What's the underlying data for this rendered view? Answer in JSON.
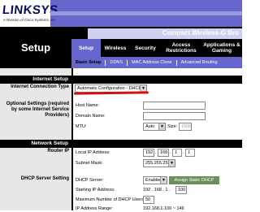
{
  "header": {
    "logo": "LINKSYS",
    "logo_sub": "A Division of Cisco Systems, Inc.",
    "product_name": "Compact Wireless-G Bro"
  },
  "nav": {
    "section_title": "Setup",
    "tabs": [
      {
        "label": "Setup",
        "active": true
      },
      {
        "label": "Wireless",
        "active": false
      },
      {
        "label": "Security",
        "active": false
      },
      {
        "label": "Access Restrictions",
        "active": false
      },
      {
        "label": "Applications & Gaming",
        "active": false
      }
    ],
    "subtabs": [
      {
        "label": "Basic Setup",
        "active": true
      },
      {
        "label": "DDNS",
        "active": false
      },
      {
        "label": "MAC Address Clone",
        "active": false
      },
      {
        "label": "Advanced Routing",
        "active": false
      }
    ]
  },
  "left": {
    "internet_setup": "Internet Setup",
    "connection_type_label": "Internet Connection Type",
    "optional_settings_label": "Optional Settings (required by some Internet Service Providers)",
    "network_setup": "Network Setup",
    "router_ip_label": "Router IP",
    "dhcp_label": "DHCP Server Setting"
  },
  "form": {
    "connection_type": "Automatic Configuration - DHCP",
    "host_name_label": "Host Name:",
    "host_name_value": "",
    "domain_name_label": "Domain Name:",
    "domain_name_value": "",
    "mtu_label": "MTU:",
    "mtu_value": "Auto",
    "size_label": "Size:",
    "size_value": "1500",
    "local_ip_label": "Local IP Address:",
    "local_ip": [
      "192",
      "168",
      "1",
      "1"
    ],
    "subnet_label": "Subnet Mask:",
    "subnet_value": "255.255.255.0",
    "dhcp_server_label": "DHCP Server:",
    "dhcp_server_value": "Enabled",
    "assign_button": "Assign Static DHCP",
    "starting_ip_label": "Starting IP Address:",
    "starting_ip_prefix": "192 . 168 . 1 .",
    "starting_ip_last": "100",
    "max_users_label": "Maximum Number of DHCP Users:",
    "max_users_value": "50",
    "ip_range_label": "IP Address Range:",
    "ip_range_value": "192.168.1.100 ~ 149"
  },
  "colors": {
    "accent": "#6666cc",
    "annotation": "#d01010"
  }
}
